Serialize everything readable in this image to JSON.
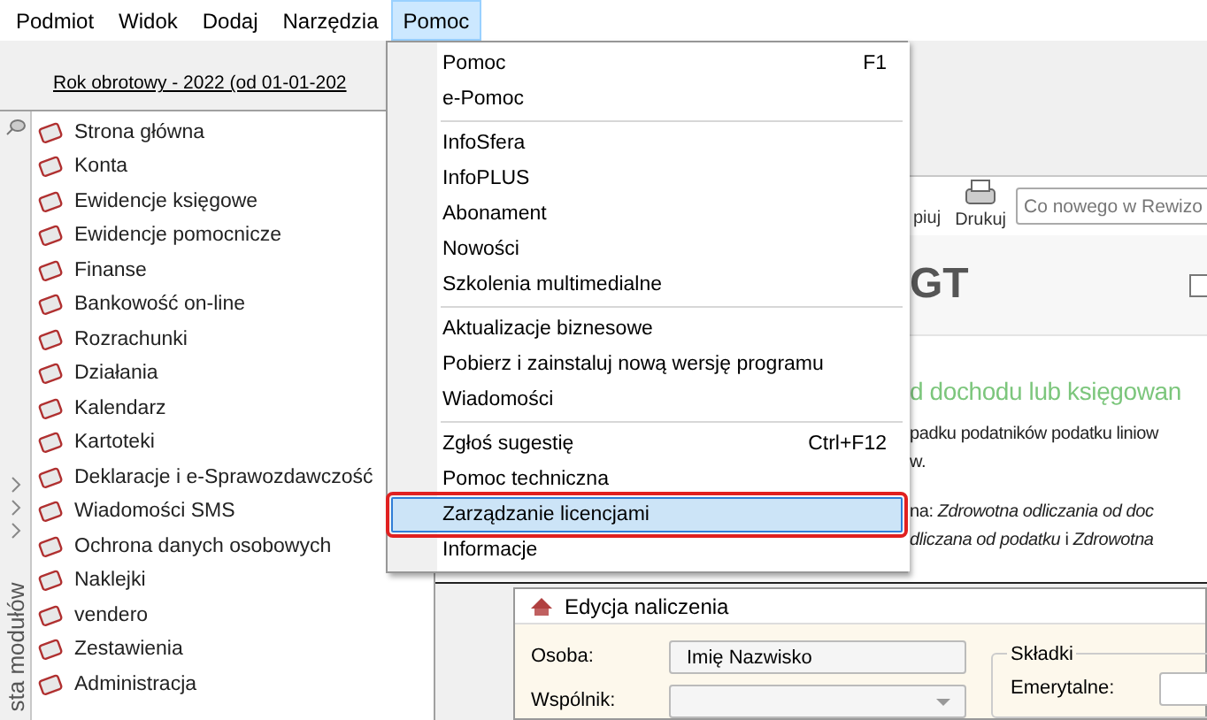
{
  "menubar": [
    {
      "label": "Podmiot",
      "selected": false
    },
    {
      "label": "Widok",
      "selected": false
    },
    {
      "label": "Dodaj",
      "selected": false
    },
    {
      "label": "Narzędzia",
      "selected": false
    },
    {
      "label": "Pomoc",
      "selected": true
    }
  ],
  "left_panel": {
    "period_tab": "Rok obrotowy - 2022  (od 01-01-202",
    "side_label": "sta modułów",
    "modules": [
      {
        "label": "Strona główna"
      },
      {
        "label": "Konta"
      },
      {
        "label": "Ewidencje księgowe"
      },
      {
        "label": "Ewidencje pomocnicze"
      },
      {
        "label": "Finanse"
      },
      {
        "label": "Bankowość on-line"
      },
      {
        "label": "Rozrachunki"
      },
      {
        "label": "Działania"
      },
      {
        "label": "Kalendarz"
      },
      {
        "label": "Kartoteki"
      },
      {
        "label": "Deklaracje i e-Sprawozdawczość"
      },
      {
        "label": "Wiadomości SMS"
      },
      {
        "label": "Ochrona danych osobowych"
      },
      {
        "label": "Naklejki"
      },
      {
        "label": "vendero"
      },
      {
        "label": "Zestawienia"
      },
      {
        "label": "Administracja"
      }
    ]
  },
  "help_menu": {
    "items": [
      {
        "kind": "item",
        "label": "Pomoc",
        "shortcut": "F1",
        "selected": false
      },
      {
        "kind": "item",
        "label": "e-Pomoc",
        "selected": false
      },
      {
        "kind": "separator"
      },
      {
        "kind": "item",
        "label": "InfoSfera",
        "selected": false
      },
      {
        "kind": "item",
        "label": "InfoPLUS",
        "selected": false
      },
      {
        "kind": "item",
        "label": "Abonament",
        "selected": false
      },
      {
        "kind": "item",
        "label": "Nowości",
        "selected": false
      },
      {
        "kind": "item",
        "label": "Szkolenia multimedialne",
        "selected": false
      },
      {
        "kind": "separator"
      },
      {
        "kind": "item",
        "label": "Aktualizacje biznesowe",
        "selected": false
      },
      {
        "kind": "item",
        "label": "Pobierz i zainstaluj nową wersję programu",
        "selected": false
      },
      {
        "kind": "item",
        "label": "Wiadomości",
        "selected": false
      },
      {
        "kind": "separator"
      },
      {
        "kind": "item",
        "label": "Zgłoś sugestię",
        "shortcut": "Ctrl+F12",
        "selected": false
      },
      {
        "kind": "item",
        "label": "Pomoc techniczna",
        "selected": false
      },
      {
        "kind": "item",
        "label": "Zarządzanie licencjami",
        "selected": true
      },
      {
        "kind": "item",
        "label": "Informacje",
        "selected": false
      }
    ]
  },
  "content": {
    "toolbar": {
      "partial_button": "piuj",
      "print_button": "Drukuj",
      "search_placeholder": "Co nowego w Rewizo"
    },
    "title": "GT",
    "checkbox": {
      "checked": false
    },
    "heading": "d dochodu lub księgowan",
    "paragraph_1": [
      "padku podatników podatku liniow",
      "w."
    ],
    "paragraph_2": [
      "na: *Zdrowotna odliczania od doc*",
      "*dliczana od podatku* i *Zdrowotna*"
    ]
  },
  "dialog": {
    "title": "Edycja naliczenia",
    "fields": [
      {
        "kind": "text",
        "label": "Osoba:",
        "value": "Imię Nazwisko"
      },
      {
        "kind": "dropdown",
        "label": "Wspólnik:"
      }
    ],
    "group": {
      "title": "Składki",
      "fields": [
        {
          "label": "Emerytalne:"
        }
      ]
    }
  }
}
